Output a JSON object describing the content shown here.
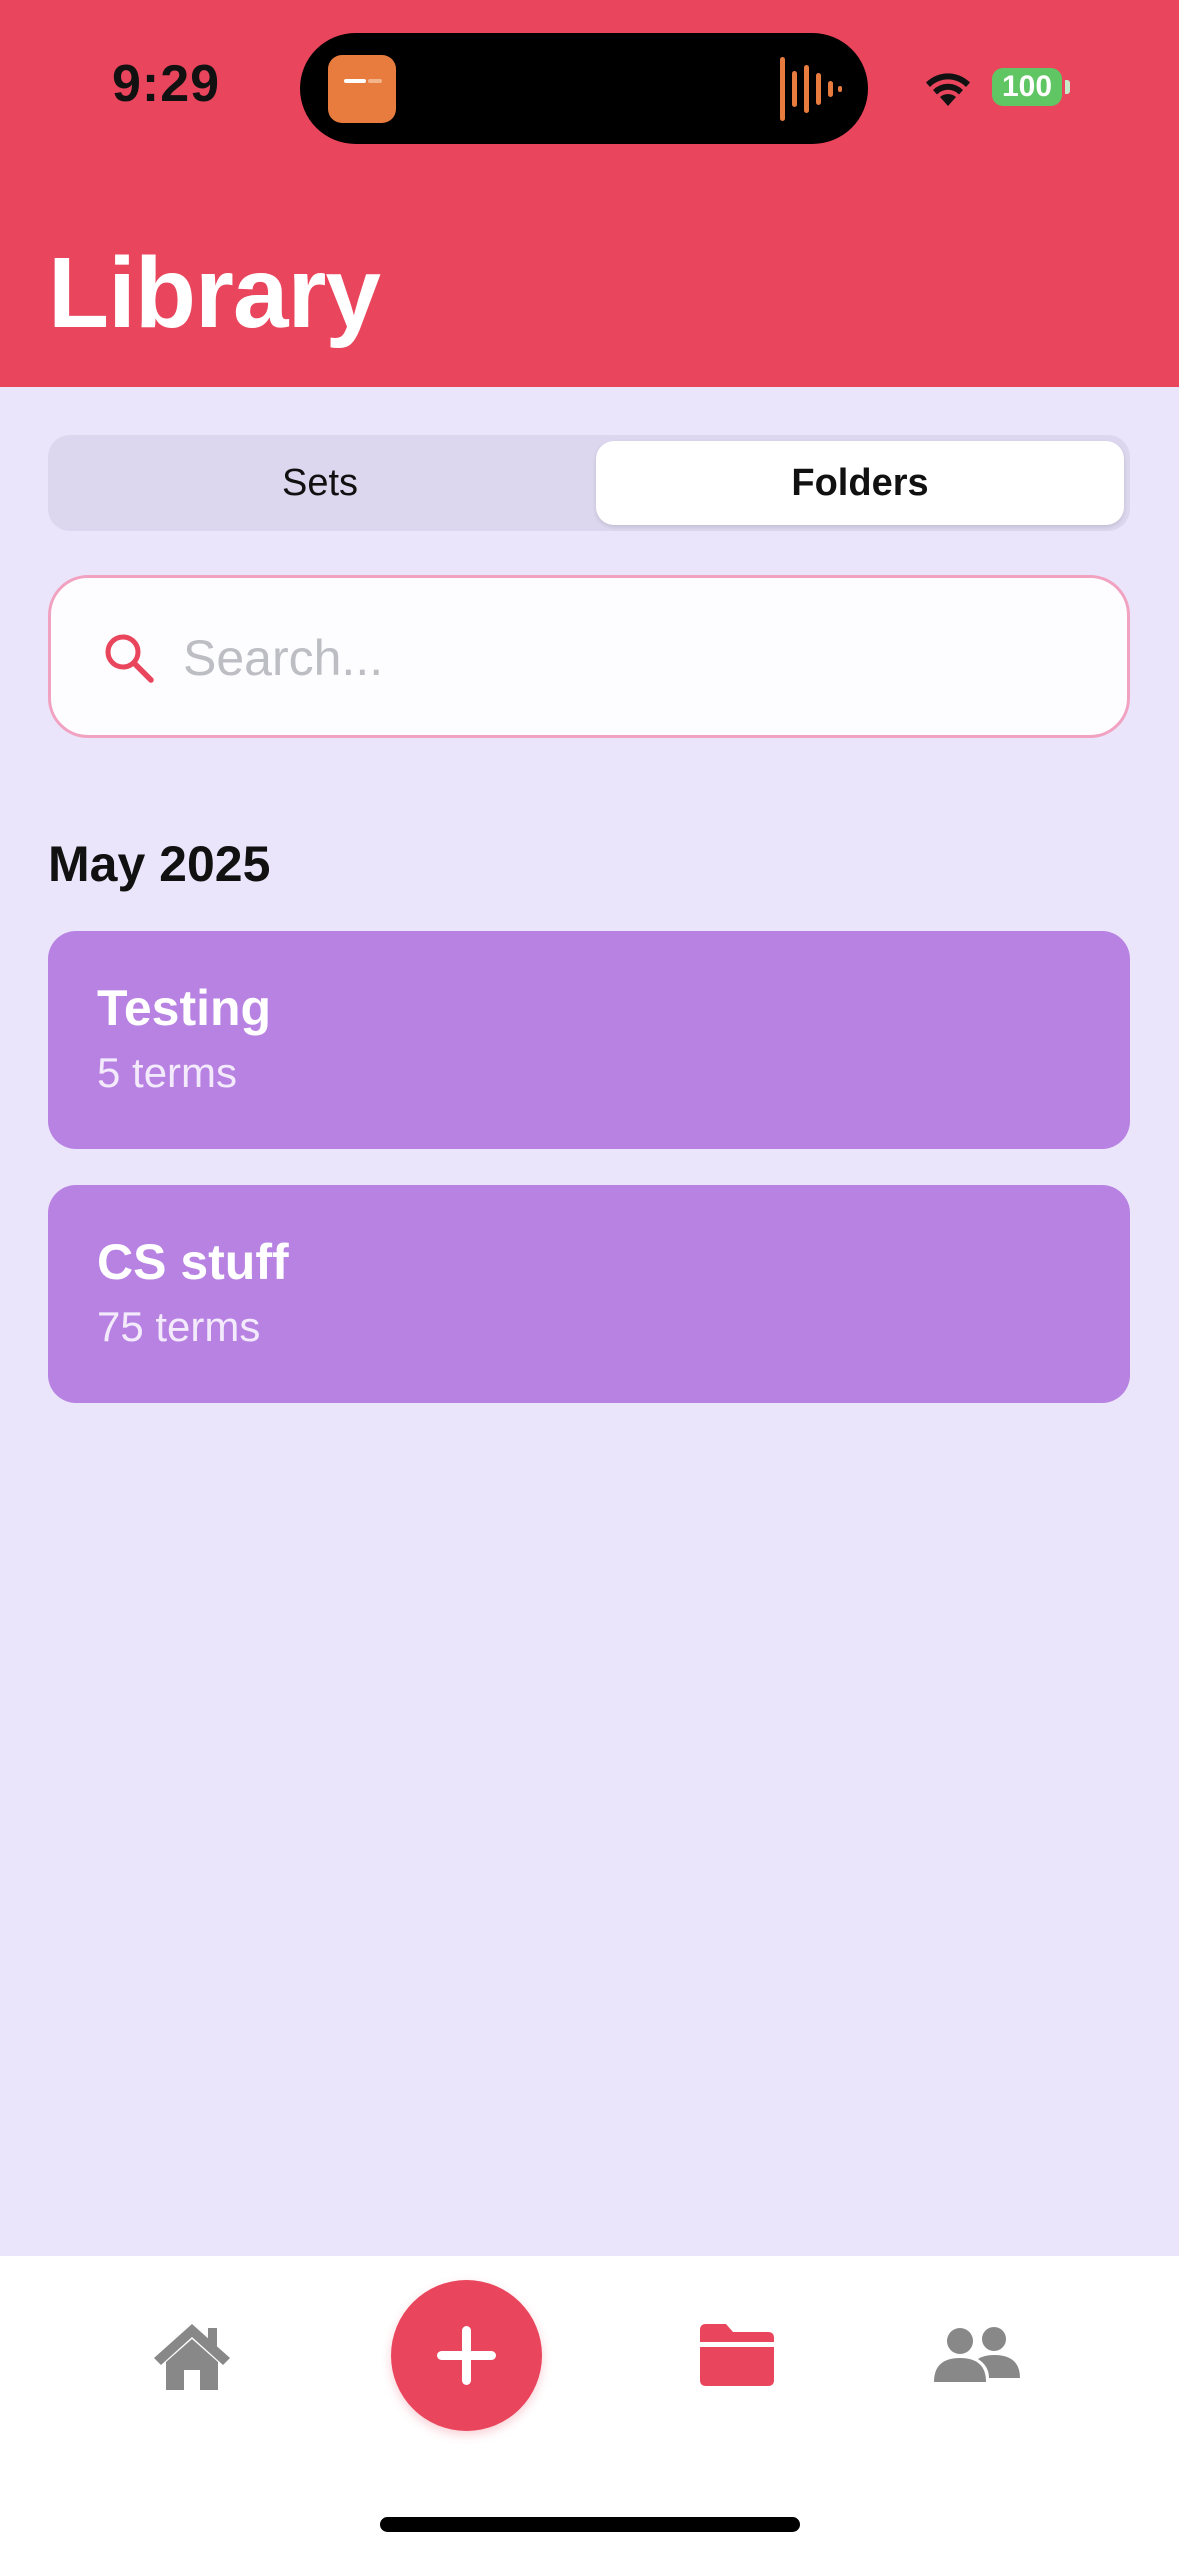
{
  "status_bar": {
    "time": "9:29",
    "battery": "100",
    "icons": [
      "wifi-icon",
      "battery-icon",
      "now-playing-waveform-icon"
    ]
  },
  "header": {
    "title": "Library"
  },
  "segmented_control": {
    "options": [
      {
        "label": "Sets",
        "selected": false
      },
      {
        "label": "Folders",
        "selected": true
      }
    ]
  },
  "search": {
    "placeholder": "Search...",
    "value": ""
  },
  "sections": [
    {
      "title": "May 2025",
      "folders": [
        {
          "name": "Testing",
          "count": "5 terms"
        },
        {
          "name": "CS stuff",
          "count": "75 terms"
        }
      ]
    }
  ],
  "tab_bar": {
    "items": [
      {
        "icon": "home-icon",
        "active": false
      },
      {
        "icon": "plus-icon",
        "active": false
      },
      {
        "icon": "folder-icon",
        "active": true
      },
      {
        "icon": "people-icon",
        "active": false
      }
    ]
  },
  "colors": {
    "accent": "#e9455c",
    "background": "#ebe5fb",
    "card": "#b882e3",
    "inactive_icon": "#888888"
  }
}
